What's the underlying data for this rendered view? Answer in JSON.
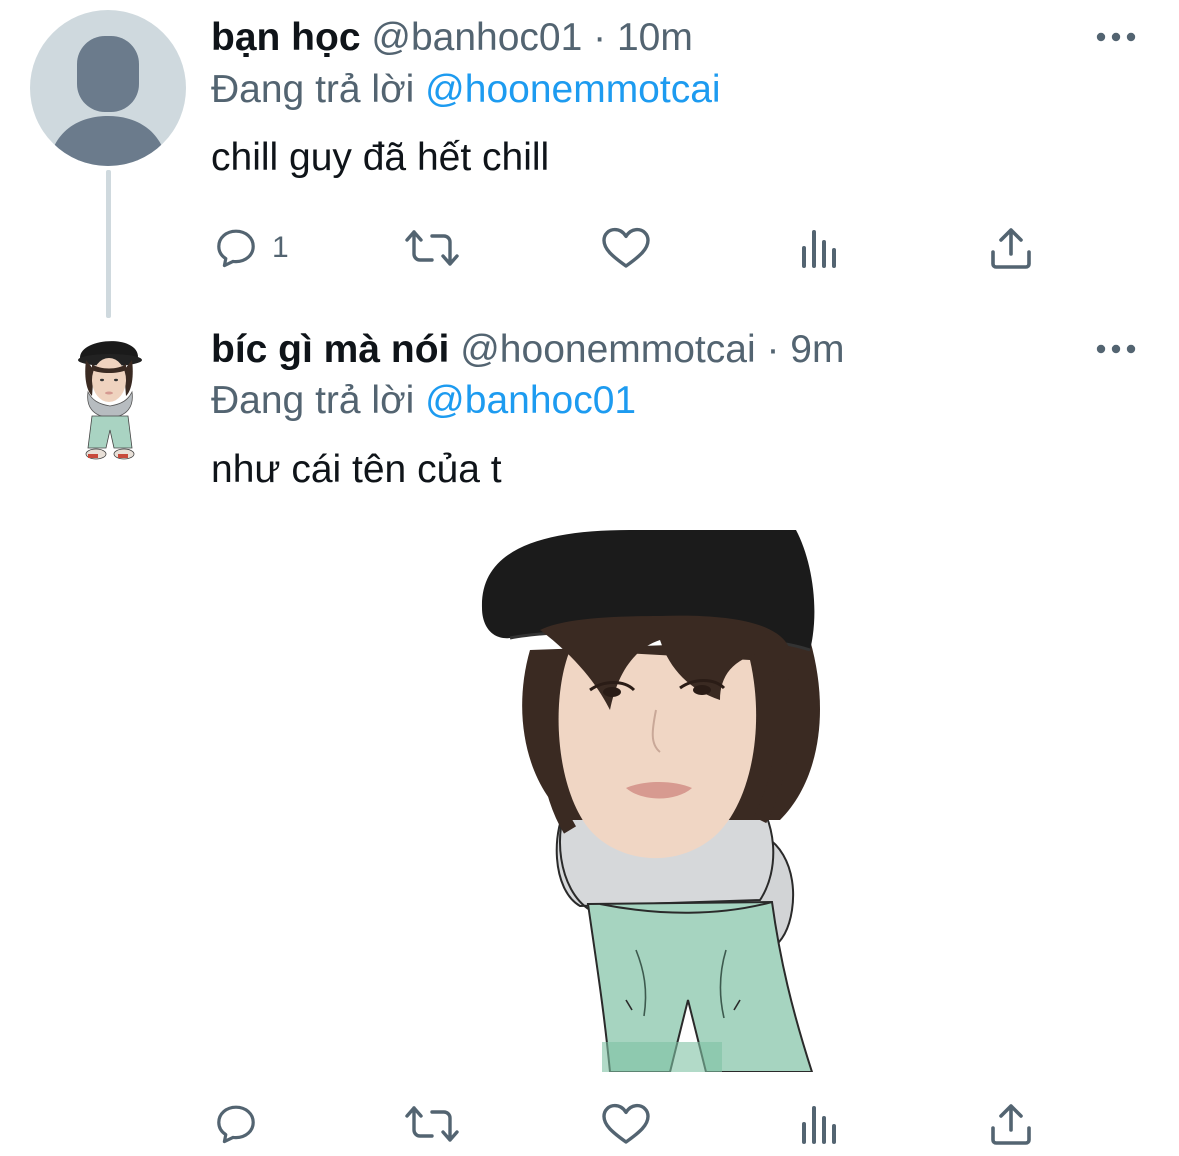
{
  "tweets": [
    {
      "display_name": "bạn học",
      "handle": "@banhoc01",
      "time": "· 10m",
      "reply_prefix": "Đang trả lời",
      "reply_to": "@hoonemmotcai",
      "text": "chill guy đã hết chill",
      "reply_count": "1",
      "avatar": "default-avatar-icon"
    },
    {
      "display_name": "bíc gì mà nói",
      "handle": "@hoonemmotcai",
      "time": "· 9m",
      "reply_prefix": "Đang trả lời",
      "reply_to": "@banhoc01",
      "text": "như cái tên của t",
      "reply_count": "",
      "avatar": "chill-guy-sticker",
      "media": "chill-guy-sticker-image"
    }
  ],
  "colors": {
    "text_primary": "#0f1419",
    "text_secondary": "#536471",
    "accent": "#1d9bf0",
    "avatar_placeholder": "#cfd9de"
  },
  "icons": [
    "more-icon",
    "reply-icon",
    "retweet-icon",
    "like-icon",
    "views-icon",
    "share-icon"
  ]
}
